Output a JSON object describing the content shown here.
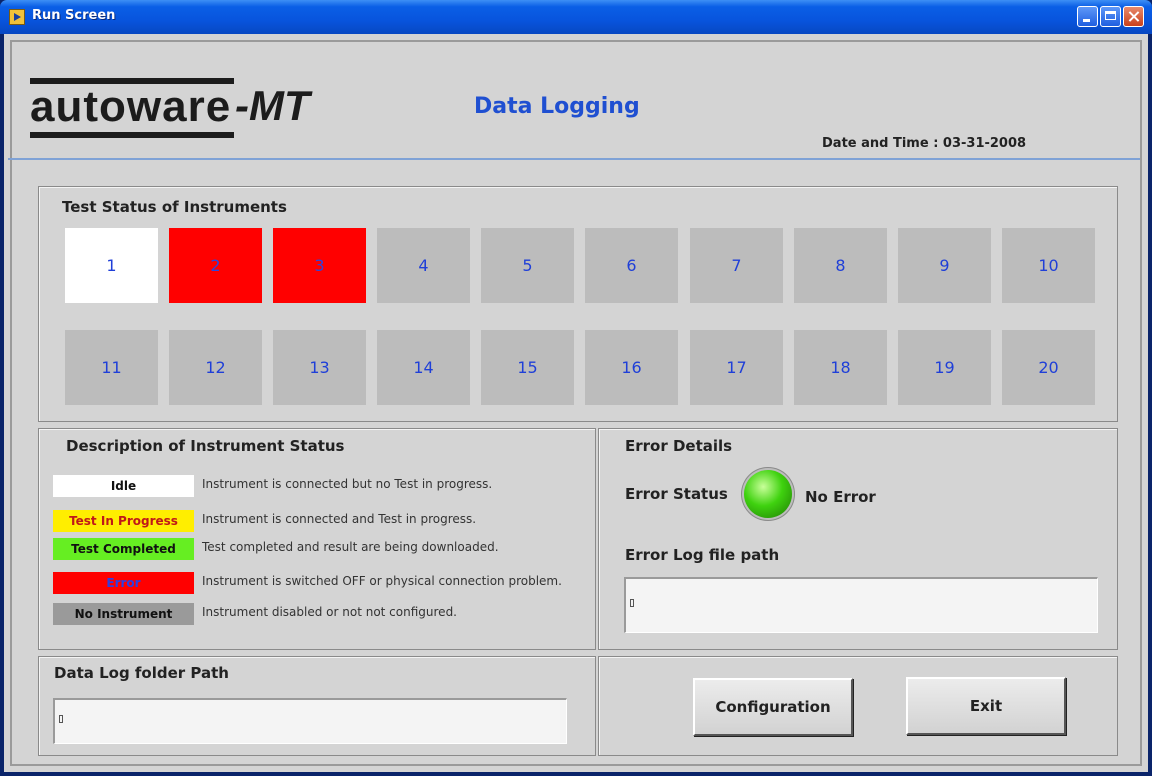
{
  "window": {
    "title": "Run Screen"
  },
  "header": {
    "logo_word": "autoware",
    "logo_suffix": "-MT",
    "title": "Data Logging",
    "datetime": "Date and Time : 03-31-2008"
  },
  "test_status": {
    "title": "Test Status of Instruments",
    "instruments": [
      {
        "label": "1",
        "status": "idle"
      },
      {
        "label": "2",
        "status": "error"
      },
      {
        "label": "3",
        "status": "error"
      },
      {
        "label": "4",
        "status": "none"
      },
      {
        "label": "5",
        "status": "none"
      },
      {
        "label": "6",
        "status": "none"
      },
      {
        "label": "7",
        "status": "none"
      },
      {
        "label": "8",
        "status": "none"
      },
      {
        "label": "9",
        "status": "none"
      },
      {
        "label": "10",
        "status": "none"
      },
      {
        "label": "11",
        "status": "none"
      },
      {
        "label": "12",
        "status": "none"
      },
      {
        "label": "13",
        "status": "none"
      },
      {
        "label": "14",
        "status": "none"
      },
      {
        "label": "15",
        "status": "none"
      },
      {
        "label": "16",
        "status": "none"
      },
      {
        "label": "17",
        "status": "none"
      },
      {
        "label": "18",
        "status": "none"
      },
      {
        "label": "19",
        "status": "none"
      },
      {
        "label": "20",
        "status": "none"
      }
    ]
  },
  "description": {
    "title": "Description of Instrument Status",
    "items": [
      {
        "label": "Idle",
        "color": "#ffffff",
        "text_color": "#111111",
        "desc": "Instrument is connected but no Test in progress."
      },
      {
        "label": "Test In Progress",
        "color": "#ffee00",
        "text_color": "#c01818",
        "desc": "Instrument is connected and Test in progress."
      },
      {
        "label": "Test Completed",
        "color": "#66ee22",
        "text_color": "#111111",
        "desc": "Test completed and result are being downloaded."
      },
      {
        "label": "Error",
        "color": "#ff0000",
        "text_color": "#2e3fe0",
        "desc": "Instrument is switched OFF or physical connection problem."
      },
      {
        "label": "No Instrument",
        "color": "#9a9a9a",
        "text_color": "#111111",
        "desc": "Instrument disabled or not not configured."
      }
    ]
  },
  "error_details": {
    "title": "Error Details",
    "status_label": "Error Status",
    "status_value": "No Error",
    "led_color": "#3fd20f",
    "log_path_label": "Error Log file path",
    "log_path_value": ""
  },
  "data_log": {
    "title": "Data Log folder Path",
    "path_value": ""
  },
  "buttons": {
    "configuration": "Configuration",
    "exit": "Exit"
  }
}
